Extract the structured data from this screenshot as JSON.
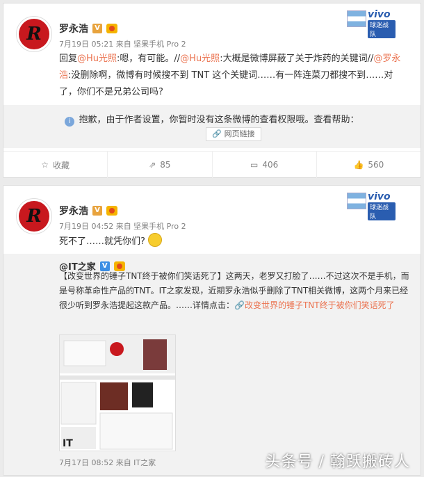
{
  "post1": {
    "author": "罗永浩",
    "verified_badge": "V",
    "meta": "7月19日 05:21 来自 坚果手机 Pro 2",
    "text": {
      "reply_prefix": "回复",
      "mention1": "@Hu光照",
      "part1": ":嗯，有可能。//",
      "mention2": "@Hu光照",
      "part2": ":大概是微博屏蔽了关于炸药的关键词//",
      "mention3": "@罗永浩",
      "part3": ":没删除啊，微博有时候搜不到 TNT 这个关键词……有一阵连菜刀都搜不到……对了，你们不是兄弟公司吗?"
    },
    "blocked_message": "抱歉，由于作者设置，你暂时没有这条微博的查看权限哦。查看帮助：",
    "weblink_label": "网页链接",
    "actions": {
      "favorite": "收藏",
      "repost_count": "85",
      "comment_count": "406",
      "like_count": "560"
    },
    "vivo": {
      "brand": "vivo",
      "team": "球迷战队"
    }
  },
  "post2": {
    "author": "罗永浩",
    "verified_badge": "V",
    "meta": "7月19日 04:52 来自 坚果手机 Pro 2",
    "text": "死不了……就凭你们?",
    "vivo": {
      "brand": "vivo",
      "team": "球迷战队"
    },
    "repost": {
      "author": "@IT之家",
      "verified_badge": "V",
      "text": "【改变世界的锤子TNT终于被你们笑话死了】这两天，老罗又打脸了……不过这次不是手机，而是号称革命性产品的TNT。IT之家发现，近期罗永浩似乎删除了TNT相关微博，这两个月来已经很少听到罗永浩提起这款产品。……详情点击：",
      "link_text": "改变世界的锤子TNT终于被你们笑话死了",
      "meta": "7月17日 08:52 来自 IT之家"
    }
  },
  "watermark": "头条号 / 翰跃搬砖人"
}
